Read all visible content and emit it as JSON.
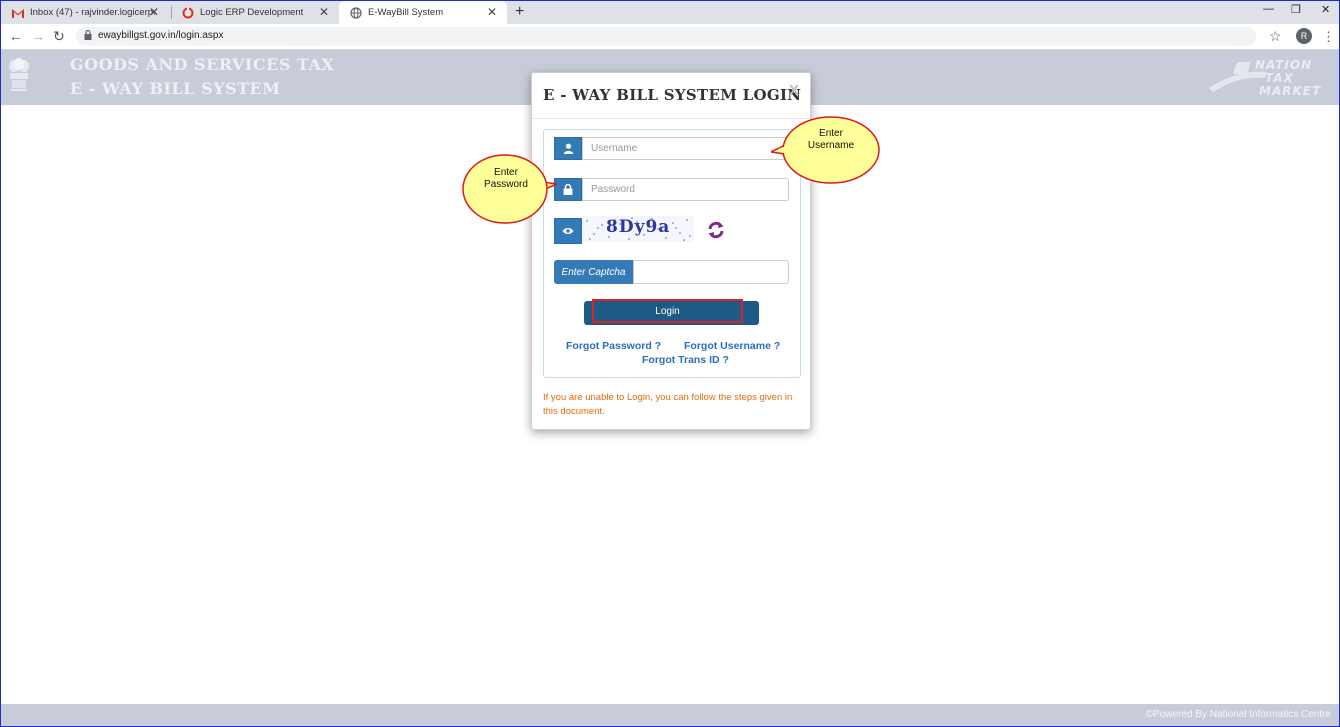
{
  "browser": {
    "tabs": [
      {
        "title": "Inbox (47) - rajvinder.logicerp@g",
        "icon": "gmail-icon"
      },
      {
        "title": "Logic ERP Development",
        "icon": "logic-erp-icon"
      },
      {
        "title": "E-WayBill System",
        "icon": "globe-icon"
      }
    ],
    "active_tab": 2,
    "new_tab": "+",
    "url": "ewaybillgst.gov.in/login.aspx",
    "profile_initial": "R",
    "controls": {
      "minimize": "—",
      "restore": "❐",
      "close": "✕"
    }
  },
  "header": {
    "line1": "GOODS AND SERVICES TAX",
    "line2": "E - WAY BILL SYSTEM",
    "brand_word1": "NATION",
    "brand_word2": "TAX",
    "brand_word3": "MARKET"
  },
  "modal": {
    "title": "E - WAY BILL SYSTEM LOGIN",
    "close": "X",
    "username_placeholder": "Username",
    "password_placeholder": "Password",
    "captcha_text": "8Dy9a",
    "captcha_label": "Enter Captcha",
    "login_label": "Login",
    "forgot_password": "Forgot Password ?",
    "forgot_username": "Forgot Username ?",
    "forgot_trans_id": "Forgot Trans ID ?",
    "help_note": "If you are unable to Login, you can follow the steps given in this document."
  },
  "callouts": {
    "username": [
      "Enter",
      "Username"
    ],
    "password": [
      "Enter",
      "Password"
    ]
  },
  "footer": {
    "text": "©Powered By National Informatics Centre"
  },
  "colors": {
    "header_bg": "#c7ccd8",
    "primary": "#337ab7",
    "login_button": "#1d5b86",
    "link": "#2a6ebb",
    "note": "#e36c0a",
    "callout_fill": "#ffff99",
    "callout_border": "#e01818"
  }
}
